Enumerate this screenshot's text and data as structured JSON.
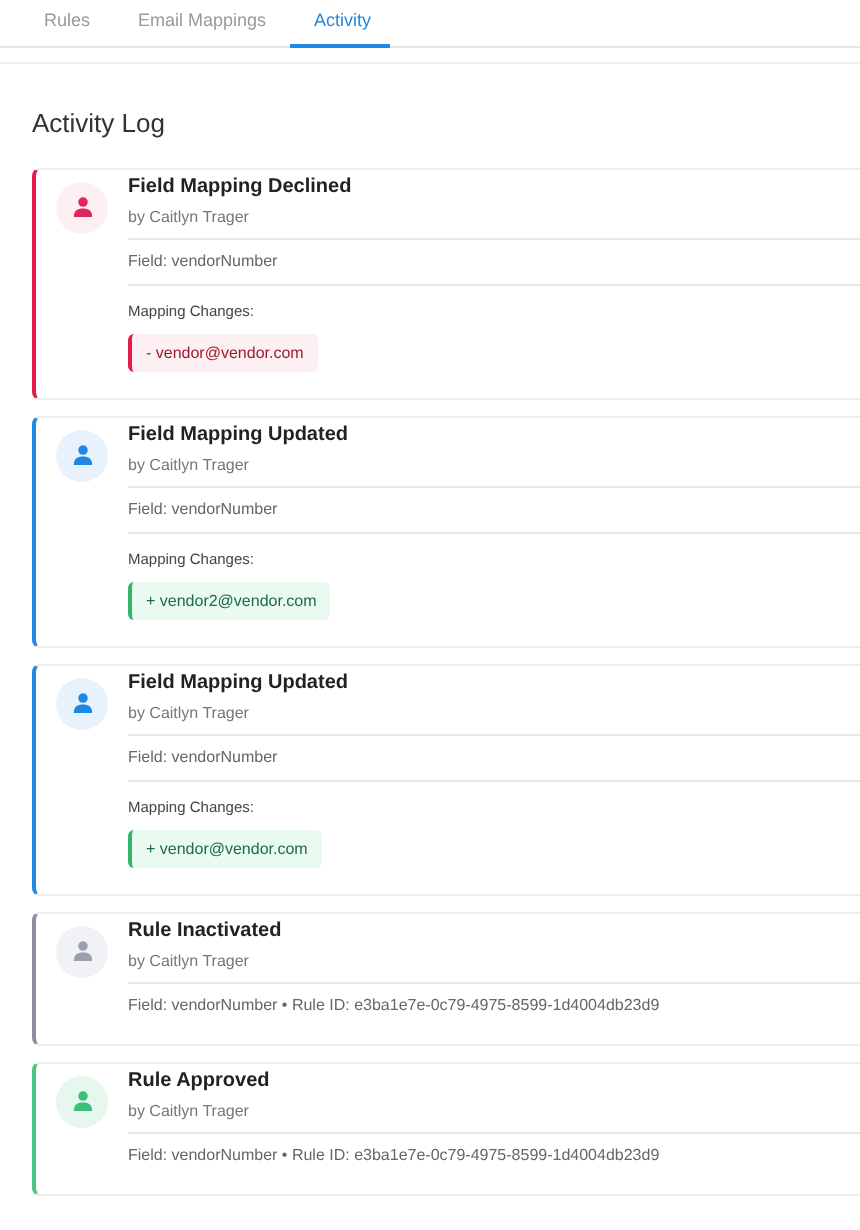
{
  "tabs": [
    {
      "label": "Rules",
      "selected": false
    },
    {
      "label": "Email Mappings",
      "selected": false
    },
    {
      "label": "Activity",
      "selected": true
    }
  ],
  "title": "Activity Log",
  "events": [
    {
      "kind": "declined",
      "title": "Field Mapping Declined",
      "author": "by Caitlyn Trager",
      "detail": "Field: vendorNumber",
      "changes_label": "Mapping Changes:",
      "change": {
        "kind": "removed",
        "text": "- vendor@vendor.com"
      }
    },
    {
      "kind": "updated",
      "title": "Field Mapping Updated",
      "author": "by Caitlyn Trager",
      "detail": "Field: vendorNumber",
      "changes_label": "Mapping Changes:",
      "change": {
        "kind": "added",
        "text": "+ vendor2@vendor.com"
      }
    },
    {
      "kind": "updated",
      "title": "Field Mapping Updated",
      "author": "by Caitlyn Trager",
      "detail": "Field: vendorNumber",
      "changes_label": "Mapping Changes:",
      "change": {
        "kind": "added",
        "text": "+ vendor@vendor.com"
      }
    },
    {
      "kind": "inactivated",
      "title": "Rule Inactivated",
      "author": "by Caitlyn Trager",
      "detail": "Field: vendorNumber • Rule ID: e3ba1e7e-0c79-4975-8599-1d4004db23d9"
    },
    {
      "kind": "approved",
      "title": "Rule Approved",
      "author": "by Caitlyn Trager",
      "detail": "Field: vendorNumber • Rule ID: e3ba1e7e-0c79-4975-8599-1d4004db23d9"
    }
  ]
}
